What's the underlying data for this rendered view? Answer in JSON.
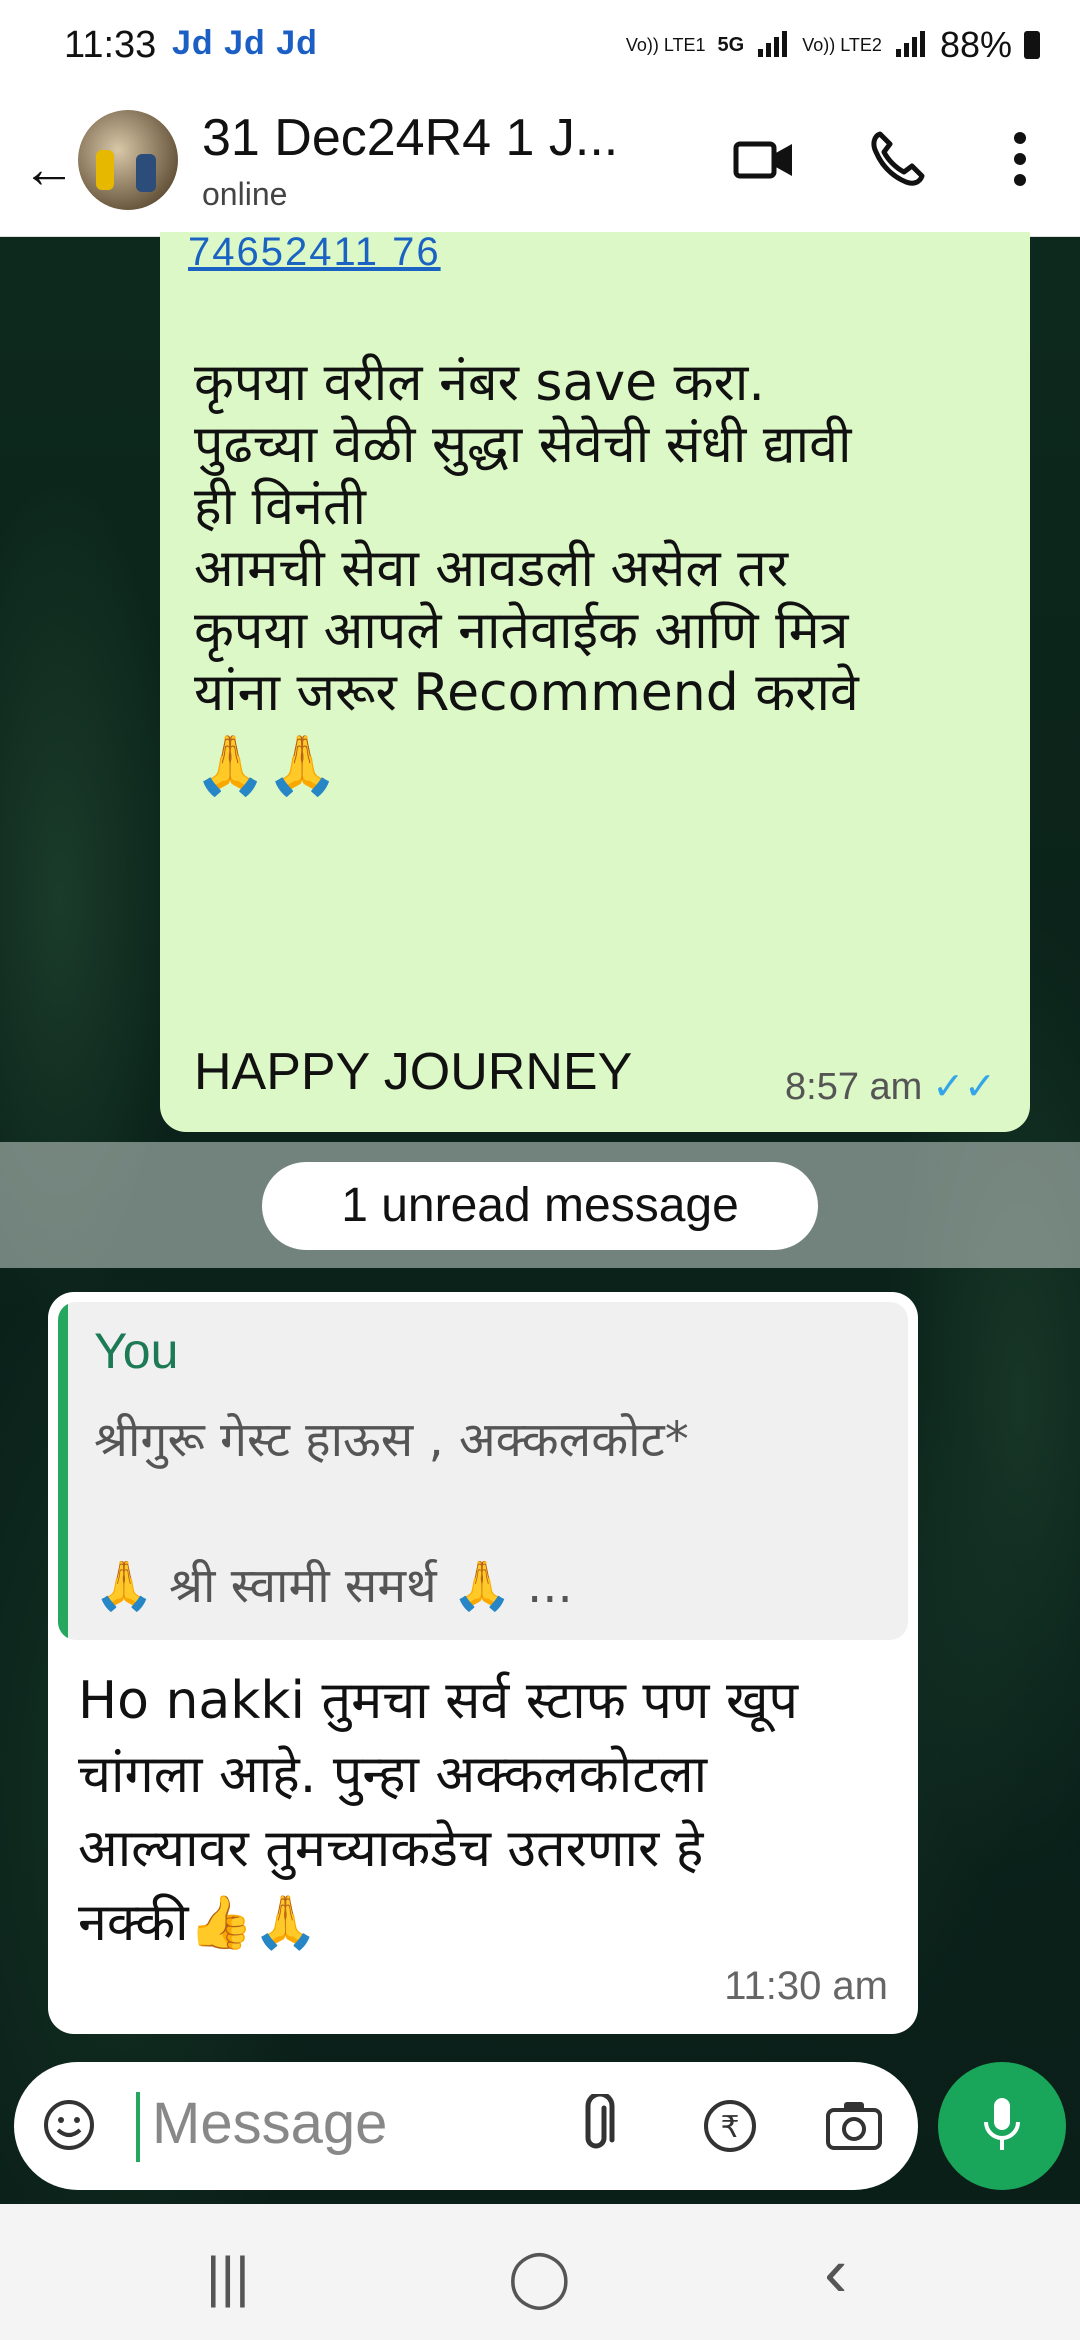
{
  "status_bar": {
    "time": "11:33",
    "apps": "Jd Jd Jd",
    "network1": "Vo)) LTE1",
    "network_5g": "5G",
    "network2": "Vo)) LTE2",
    "battery": "88%"
  },
  "header": {
    "title": "31 Dec24R4 1 J...",
    "subtitle": "online"
  },
  "messages": {
    "outgoing": {
      "cut_link": "74652411 76",
      "lines": [
        "कृपया वरील नंबर save करा.",
        "पुढच्या वेळी सुद्धा सेवेची संधी द्यावी",
        "ही विनंती",
        "आमची सेवा आवडली असेल तर",
        "कृपया आपले नातेवाईक आणि मित्र",
        "यांना जरूर Recommend करावे",
        "🙏🙏"
      ],
      "footer": "HAPPY JOURNEY",
      "time": "8:57 am",
      "ticks": "✓✓"
    },
    "unread_label": "1 unread message",
    "incoming": {
      "quote_author": "You",
      "quote_line1": "श्रीगुरू गेस्ट हाऊस , अक्कलकोट*",
      "quote_line2": "🙏 श्री स्वामी समर्थ 🙏 ...",
      "lines": [
        "Ho nakki तुमचा सर्व स्टाफ पण खूप",
        "चांगला आहे. पुन्हा अक्कलकोटला",
        "आल्यावर तुमच्याकडेच उतरणार हे",
        "नक्की👍🙏"
      ],
      "time": "11:30 am"
    }
  },
  "composer": {
    "placeholder": "Message"
  },
  "nav": {
    "recents": "|||",
    "home": "◯",
    "back": "‹"
  },
  "colors": {
    "outgoing_bubble": "#dcf8c6",
    "accent_green": "#1aa65a",
    "tick_blue": "#34a5e8"
  }
}
